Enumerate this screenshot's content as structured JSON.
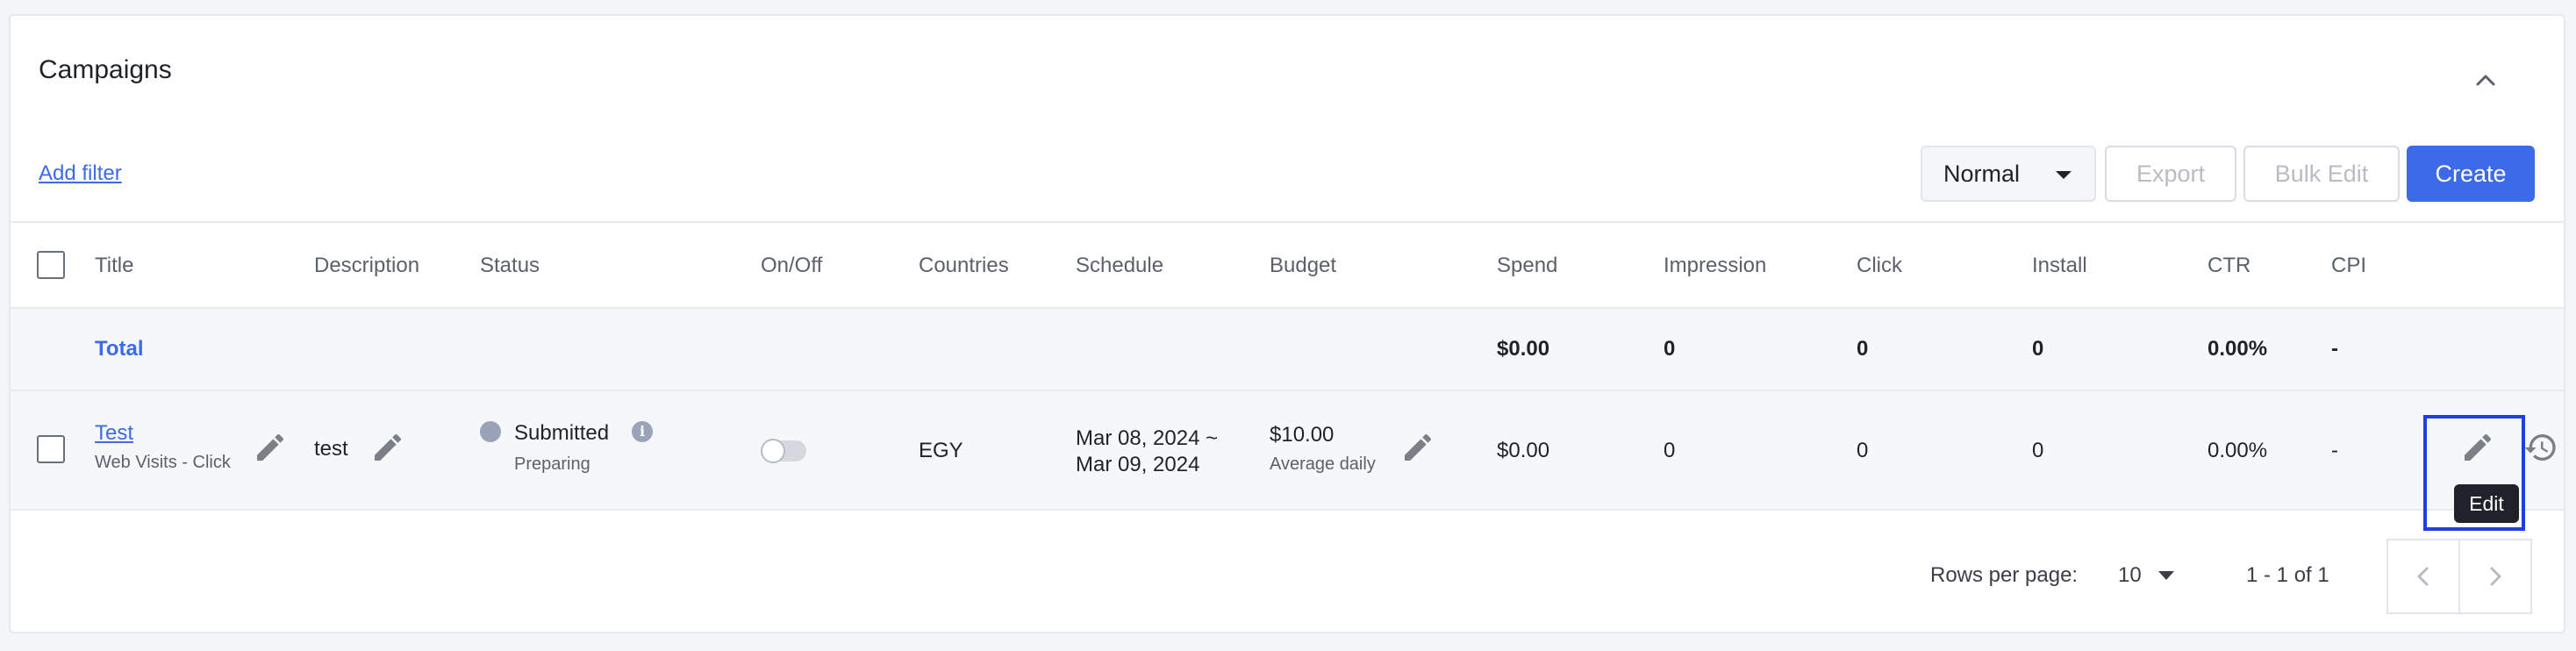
{
  "header": {
    "title": "Campaigns"
  },
  "toolbar": {
    "add_filter": "Add filter",
    "view_select": "Normal",
    "export": "Export",
    "bulk_edit": "Bulk Edit",
    "create": "Create"
  },
  "table": {
    "columns": [
      "Title",
      "Description",
      "Status",
      "On/Off",
      "Countries",
      "Schedule",
      "Budget",
      "Spend",
      "Impression",
      "Click",
      "Install",
      "CTR",
      "CPI"
    ],
    "total": {
      "label": "Total",
      "spend": "$0.00",
      "impression": "0",
      "click": "0",
      "install": "0",
      "ctr": "0.00%",
      "cpi": "-"
    },
    "rows": [
      {
        "title": "Test",
        "title_sub": "Web Visits - Click",
        "description": "test",
        "status": "Submitted",
        "status_sub": "Preparing",
        "on_off": false,
        "countries": "EGY",
        "schedule_start": "Mar 08, 2024 ~",
        "schedule_end": "Mar 09, 2024",
        "budget": "$10.00",
        "budget_sub": "Average daily",
        "spend": "$0.00",
        "impression": "0",
        "click": "0",
        "install": "0",
        "ctr": "0.00%",
        "cpi": "-"
      }
    ]
  },
  "tooltip": {
    "edit": "Edit"
  },
  "footer": {
    "rows_per_page_label": "Rows per page:",
    "rows_per_page_value": "10",
    "range": "1 - 1 of 1"
  },
  "colors": {
    "accent": "#3d6ae6",
    "highlight_box": "#1f3fe0",
    "status_dot": "#9aa3b8"
  },
  "icons": [
    "chevron-up-icon",
    "caret-down-icon",
    "pencil-icon",
    "info-icon",
    "history-icon",
    "chevron-left-icon",
    "chevron-right-icon"
  ]
}
